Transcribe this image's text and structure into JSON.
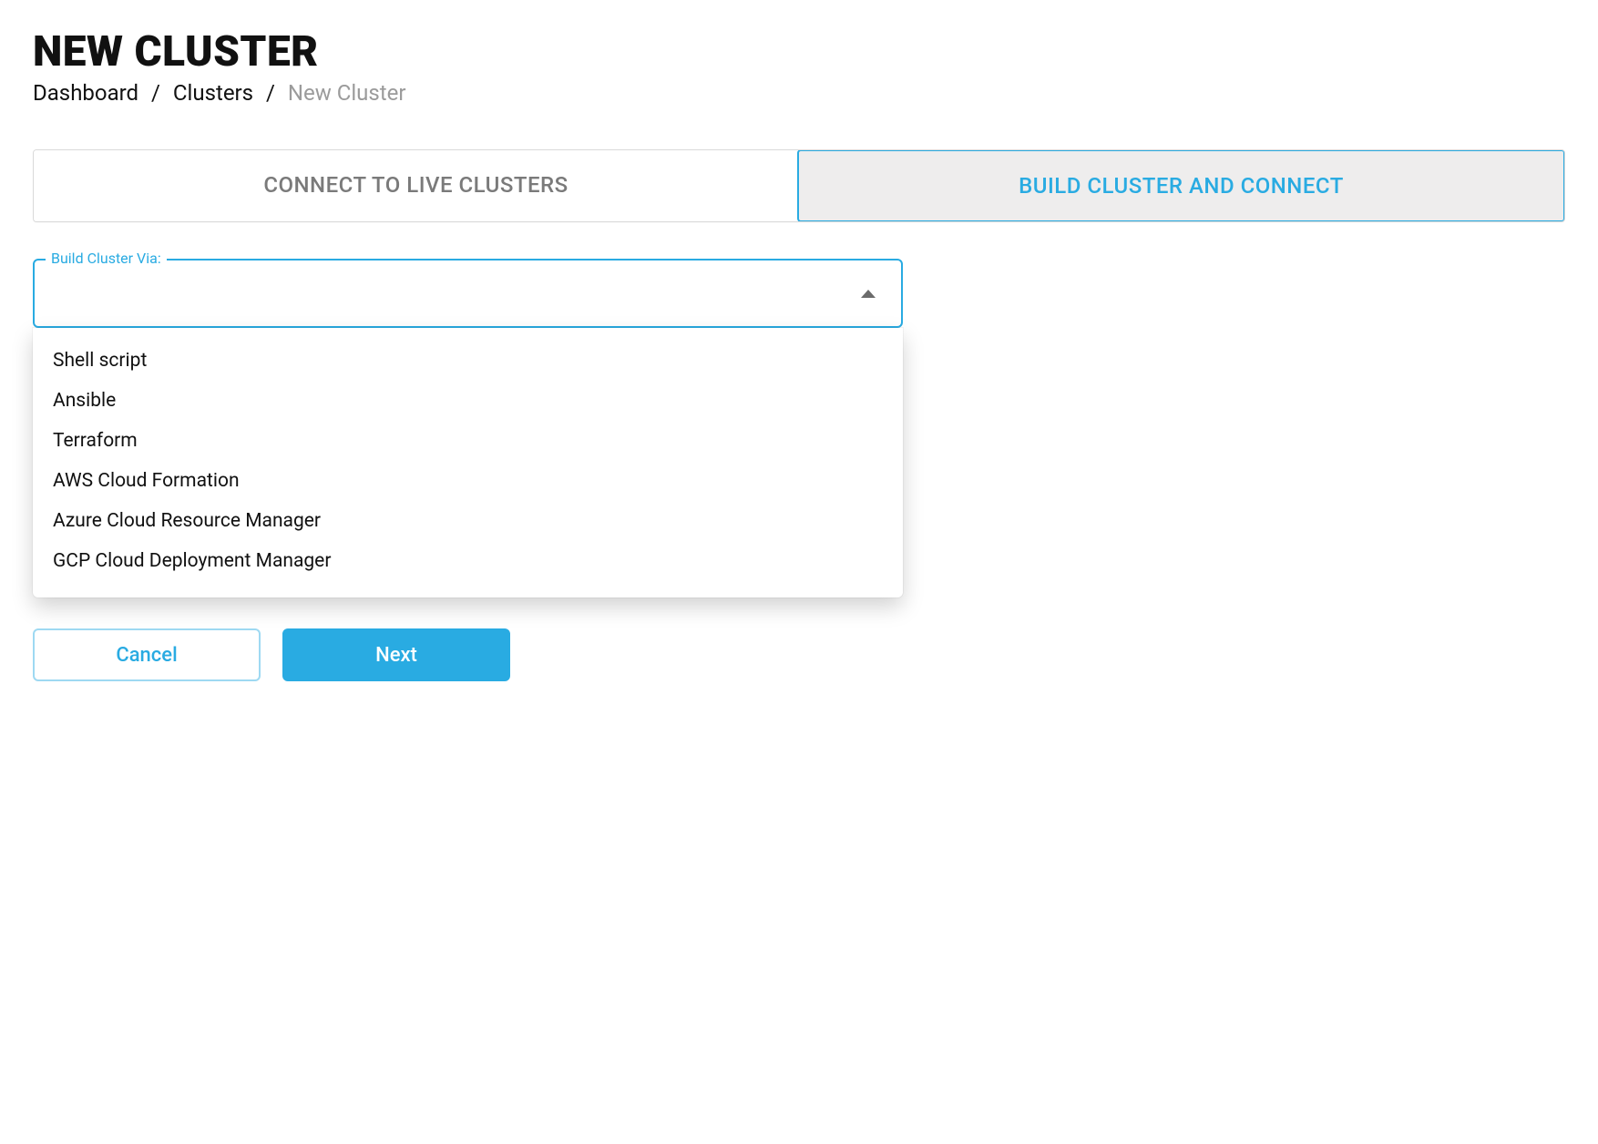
{
  "header": {
    "title": "NEW CLUSTER"
  },
  "breadcrumb": {
    "items": [
      {
        "label": "Dashboard",
        "current": false
      },
      {
        "label": "Clusters",
        "current": false
      },
      {
        "label": "New Cluster",
        "current": true
      }
    ],
    "separator": "/"
  },
  "tabs": {
    "items": [
      {
        "label": "CONNECT TO LIVE CLUSTERS",
        "active": false
      },
      {
        "label": "BUILD CLUSTER AND CONNECT",
        "active": true
      }
    ]
  },
  "form": {
    "build_via": {
      "label": "Build Cluster Via:",
      "value": "",
      "options": [
        "Shell script",
        "Ansible",
        "Terraform",
        "AWS Cloud Formation",
        "Azure Cloud Resource Manager",
        "GCP Cloud Deployment Manager"
      ]
    }
  },
  "actions": {
    "cancel": "Cancel",
    "next": "Next"
  },
  "colors": {
    "accent": "#29abe2"
  }
}
